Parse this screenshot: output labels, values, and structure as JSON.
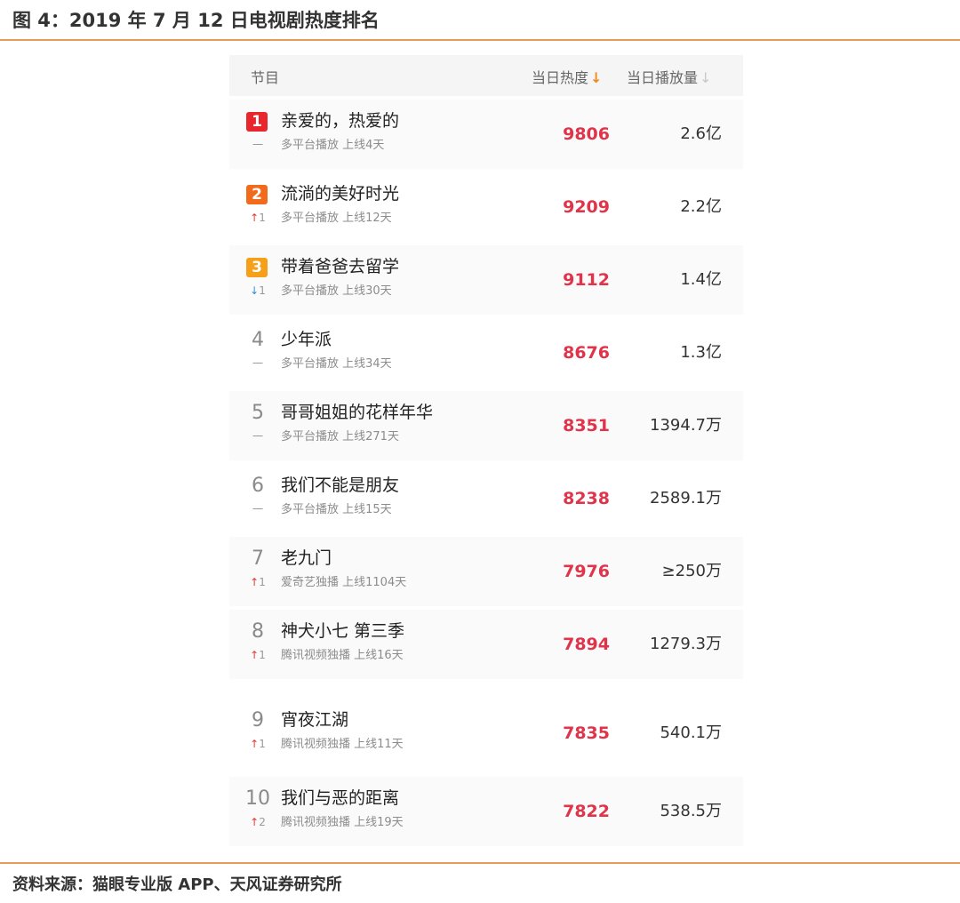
{
  "figure": {
    "title": "图 4：2019 年 7 月 12 日电视剧热度排名",
    "source": "资料来源：猫眼专业版 APP、天风证券研究所"
  },
  "colors": {
    "accent_rule": "#e89a5a",
    "heat_red": "#e0344b",
    "rank1": "#e8262b",
    "rank2": "#f26a1b",
    "rank3": "#f6a019",
    "trend_up": "#e53935",
    "trend_down": "#2f8fd8"
  },
  "header": {
    "program_label": "节目",
    "heat_label": "当日热度",
    "plays_label": "当日播放量",
    "sort_active_icon": "↓",
    "sort_inactive_icon": "↓"
  },
  "rows": [
    {
      "rank": "1",
      "trend_icon": "",
      "trend_text": "一",
      "name": "亲爱的，热爱的",
      "meta": "多平台播放 上线4天",
      "heat": "9806",
      "plays": "2.6亿"
    },
    {
      "rank": "2",
      "trend_icon": "↑",
      "trend_text": "1",
      "name": "流淌的美好时光",
      "meta": "多平台播放 上线12天",
      "heat": "9209",
      "plays": "2.2亿"
    },
    {
      "rank": "3",
      "trend_icon": "↓",
      "trend_text": "1",
      "name": "带着爸爸去留学",
      "meta": "多平台播放 上线30天",
      "heat": "9112",
      "plays": "1.4亿"
    },
    {
      "rank": "4",
      "trend_icon": "",
      "trend_text": "一",
      "name": "少年派",
      "meta": "多平台播放 上线34天",
      "heat": "8676",
      "plays": "1.3亿"
    },
    {
      "rank": "5",
      "trend_icon": "",
      "trend_text": "一",
      "name": "哥哥姐姐的花样年华",
      "meta": "多平台播放 上线271天",
      "heat": "8351",
      "plays": "1394.7万"
    },
    {
      "rank": "6",
      "trend_icon": "",
      "trend_text": "一",
      "name": "我们不能是朋友",
      "meta": "多平台播放 上线15天",
      "heat": "8238",
      "plays": "2589.1万"
    },
    {
      "rank": "7",
      "trend_icon": "↑",
      "trend_text": "1",
      "name": "老九门",
      "meta": "爱奇艺独播 上线1104天",
      "heat": "7976",
      "plays": "≥250万"
    },
    {
      "rank": "8",
      "trend_icon": "↑",
      "trend_text": "1",
      "name": "神犬小七 第三季",
      "meta": "腾讯视频独播 上线16天",
      "heat": "7894",
      "plays": "1279.3万"
    },
    {
      "rank": "9",
      "trend_icon": "↑",
      "trend_text": "1",
      "name": "宵夜江湖",
      "meta": "腾讯视频独播 上线11天",
      "heat": "7835",
      "plays": "540.1万"
    },
    {
      "rank": "10",
      "trend_icon": "↑",
      "trend_text": "2",
      "name": "我们与恶的距离",
      "meta": "腾讯视频独播 上线19天",
      "heat": "7822",
      "plays": "538.5万"
    }
  ]
}
